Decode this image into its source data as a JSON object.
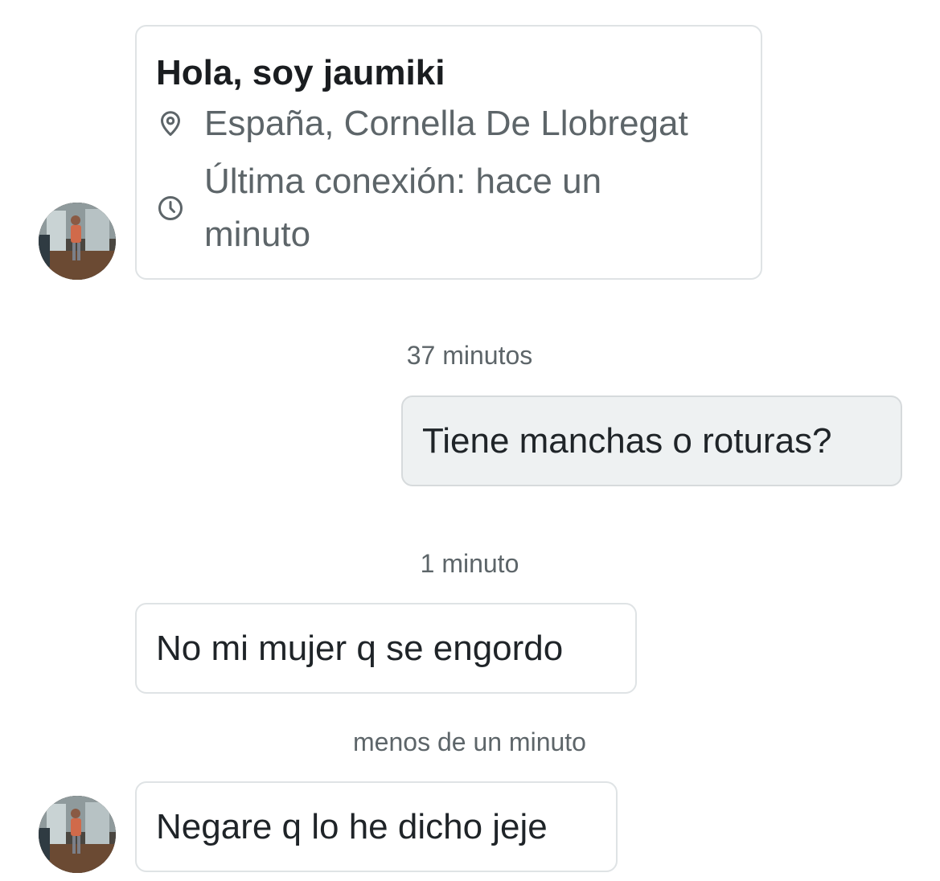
{
  "profile_card": {
    "greeting": "Hola, soy jaumiki",
    "location": "España, Cornella De Llobregat",
    "last_seen_line1": "Última conexión: hace un",
    "last_seen_line2": "minuto",
    "location_icon": "location-pin-icon",
    "time_icon": "clock-icon"
  },
  "messages": [
    {
      "timestamp": "37 minutos",
      "text": "Tiene manchas o roturas?",
      "from": "me"
    },
    {
      "timestamp": "1 minuto",
      "text": "No mi mujer q se engordo",
      "from": "other"
    },
    {
      "timestamp": "menos de un minuto",
      "text": "Negare q lo he dicho jeje",
      "from": "other"
    }
  ],
  "colors": {
    "text_primary": "#1f2428",
    "text_secondary": "#5d6569",
    "bubble_border": "#dfe3e5",
    "my_bubble_bg": "#eef1f2"
  }
}
